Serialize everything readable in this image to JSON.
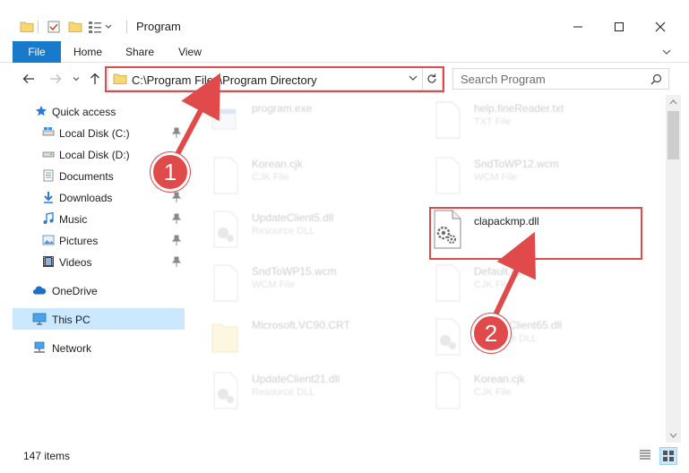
{
  "window": {
    "title": "Program",
    "minimize_icon": "minimize-icon",
    "maximize_icon": "maximize-icon",
    "close_icon": "close-icon"
  },
  "ribbon": {
    "tabs": [
      {
        "label": "File"
      },
      {
        "label": "Home"
      },
      {
        "label": "Share"
      },
      {
        "label": "View"
      }
    ]
  },
  "address": {
    "path": "C:\\Program Files\\Program Directory",
    "search_placeholder": "Search Program"
  },
  "sidebar": {
    "items": [
      {
        "label": "Quick access",
        "icon": "star-icon"
      },
      {
        "label": "Local Disk (C:)",
        "icon": "drive-icon",
        "pinned": true
      },
      {
        "label": "Local Disk (D:)",
        "icon": "drive-icon",
        "pinned": false
      },
      {
        "label": "Documents",
        "icon": "documents-icon",
        "pinned": true
      },
      {
        "label": "Downloads",
        "icon": "downloads-icon",
        "pinned": true
      },
      {
        "label": "Music",
        "icon": "music-icon",
        "pinned": true
      },
      {
        "label": "Pictures",
        "icon": "pictures-icon",
        "pinned": true
      },
      {
        "label": "Videos",
        "icon": "videos-icon",
        "pinned": true
      },
      {
        "label": "OneDrive",
        "icon": "cloud-icon"
      },
      {
        "label": "This PC",
        "icon": "computer-icon",
        "selected": true
      },
      {
        "label": "Network",
        "icon": "network-icon"
      }
    ]
  },
  "files": [
    {
      "name": "program.exe",
      "type": "",
      "icon": "exe-icon"
    },
    {
      "name": "help.fineReader.txt",
      "type": "TXT File",
      "icon": "file-icon"
    },
    {
      "name": "Korean.cjk",
      "type": "CJK File",
      "icon": "file-icon"
    },
    {
      "name": "SndToWP12.wcm",
      "type": "WCM File",
      "icon": "file-icon"
    },
    {
      "name": "UpdateClient5.dll",
      "type": "Resource DLL",
      "icon": "dll-icon"
    },
    {
      "name": "clapackmp.dll",
      "type": "",
      "icon": "dll-icon"
    },
    {
      "name": "SndToWP15.wcm",
      "type": "WCM File",
      "icon": "file-icon"
    },
    {
      "name": "Default.cjk",
      "type": "CJK File",
      "icon": "file-icon"
    },
    {
      "name": "Microsoft.VC90.CRT",
      "type": "",
      "icon": "folder-icon"
    },
    {
      "name": "UpdateClient65.dll",
      "type": "Resource DLL",
      "icon": "dll-icon"
    },
    {
      "name": "UpdateClient21.dll",
      "type": "Resource DLL",
      "icon": "dll-icon"
    },
    {
      "name": "Korean.cjk",
      "type": "CJK File",
      "icon": "file-icon"
    }
  ],
  "status": {
    "item_count": "147 items"
  },
  "callouts": [
    {
      "label": "1"
    },
    {
      "label": "2"
    }
  ],
  "colors": {
    "accent": "#1979ca",
    "highlight": "#e04a4a",
    "selected": "#cce8ff"
  }
}
